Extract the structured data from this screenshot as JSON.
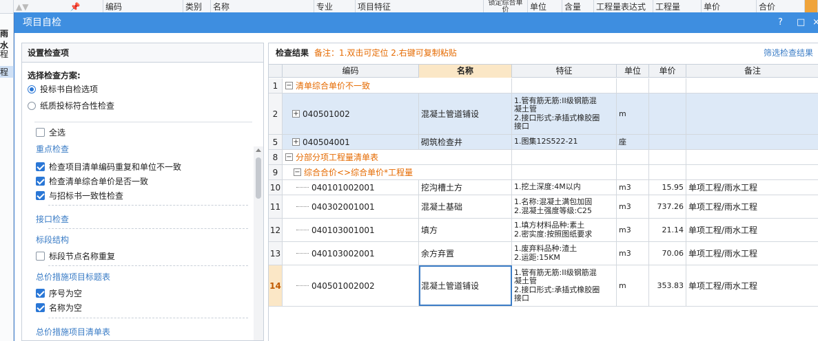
{
  "bg": {
    "headers": [
      "编码",
      "类别",
      "名称",
      "专业",
      "项目特征",
      "锁定综合单价",
      "单位",
      "含量",
      "工程量表达式",
      "工程量",
      "单价",
      "合价"
    ],
    "left_labels": [
      "雨水",
      "程",
      "程"
    ]
  },
  "dialog": {
    "title": "项目自检",
    "help": "?",
    "maximize": "□",
    "close": "×"
  },
  "left": {
    "title": "设置检查项",
    "scheme_label": "选择检查方案:",
    "schemes": [
      {
        "label": "投标书自检选项",
        "selected": true
      },
      {
        "label": "纸质投标符合性检查",
        "selected": false
      }
    ],
    "select_all": "全选",
    "groups": [
      {
        "title": "重点检查",
        "items": [
          {
            "label": "检查项目清单编码重复和单位不一致",
            "checked": true
          },
          {
            "label": "检查清单综合单价是否一致",
            "checked": true
          },
          {
            "label": "与招标书一致性检查",
            "checked": true
          }
        ]
      },
      {
        "title": "接口检查",
        "items": []
      },
      {
        "title": "标段结构",
        "items": [
          {
            "label": "标段节点名称重复",
            "checked": false
          }
        ]
      },
      {
        "title": "总价措施项目标题表",
        "items": [
          {
            "label": "序号为空",
            "checked": true
          },
          {
            "label": "名称为空",
            "checked": true
          }
        ]
      },
      {
        "title": "总价措施项目清单表",
        "items": []
      }
    ]
  },
  "right": {
    "title": "检查结果",
    "note": "备注：1.双击可定位 2.右键可复制粘贴",
    "filter_link": "筛选检查结果",
    "columns": [
      "编码",
      "名称",
      "特征",
      "单位",
      "单价",
      "备注"
    ],
    "rows": [
      {
        "num": "1",
        "kind": "cat",
        "text": "清单综合单价不一致",
        "toggle": "−"
      },
      {
        "num": "2",
        "kind": "item",
        "toggle": "+",
        "code": "040501002",
        "name": "混凝土管道铺设",
        "feature": [
          "1.管有筋无筋:II级钢筋混",
          "凝土管",
          "2.接口形式:承插式橡胶圈",
          "接口"
        ],
        "unit": "m",
        "price": "",
        "remark": "",
        "hl": true
      },
      {
        "num": "5",
        "kind": "item",
        "toggle": "+",
        "code": "040504001",
        "name": "砌筑检查井",
        "feature": [
          "1.图集12S522-21"
        ],
        "unit": "座",
        "price": "",
        "remark": "",
        "hl": true
      },
      {
        "num": "8",
        "kind": "cat",
        "text": "分部分项工程量清单表",
        "toggle": "−"
      },
      {
        "num": "9",
        "kind": "subcat",
        "text": "综合合价<>综合单价*工程量",
        "toggle": "−"
      },
      {
        "num": "10",
        "kind": "leaf",
        "code": "040101002001",
        "name": "挖沟槽土方",
        "feature": [
          "1.挖土深度:4M以内"
        ],
        "unit": "m3",
        "price": "15.95",
        "remark": "单项工程/雨水工程"
      },
      {
        "num": "11",
        "kind": "leaf",
        "code": "040302001001",
        "name": "混凝土基础",
        "feature": [
          "1.名称:混凝土满包加固",
          "2.混凝土强度等级:C25"
        ],
        "unit": "m3",
        "price": "737.26",
        "remark": "单项工程/雨水工程"
      },
      {
        "num": "12",
        "kind": "leaf",
        "code": "040103001001",
        "name": "填方",
        "feature": [
          "1.填方材料品种:素土",
          "2.密实度:按照图纸要求"
        ],
        "unit": "m3",
        "price": "21.14",
        "remark": "单项工程/雨水工程"
      },
      {
        "num": "13",
        "kind": "leaf",
        "code": "040103002001",
        "name": "余方弃置",
        "feature": [
          "1.废弃料品种:渣土",
          "2.运距:15KM"
        ],
        "unit": "m3",
        "price": "70.06",
        "remark": "单项工程/雨水工程"
      },
      {
        "num": "14",
        "kind": "leaf",
        "code": "040501002002",
        "name": "混凝土管道铺设",
        "feature": [
          "1.管有筋无筋:II级钢筋混",
          "凝土管",
          "2.接口形式:承插式橡胶圈",
          "接口"
        ],
        "unit": "m",
        "price": "353.83",
        "remark": "单项工程/雨水工程",
        "selected": true
      }
    ]
  }
}
